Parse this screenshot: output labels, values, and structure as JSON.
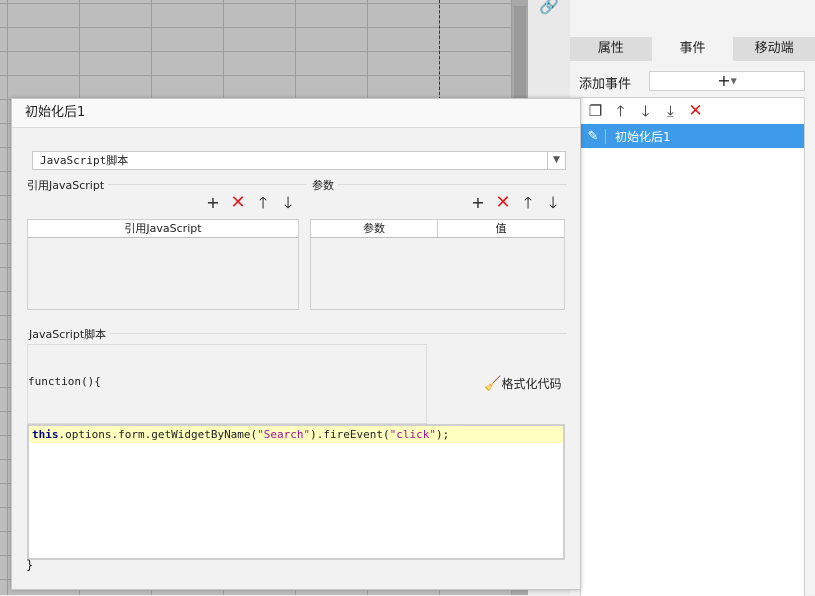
{
  "right_panel": {
    "tabs": [
      {
        "label": "属性",
        "active": false
      },
      {
        "label": "事件",
        "active": true
      },
      {
        "label": "移动端",
        "active": false
      }
    ],
    "add_event_label": "添加事件",
    "add_event_button": "+",
    "toolbar_icons": [
      "copy-icon",
      "arrow-up-icon",
      "arrow-down-icon",
      "move-to-bottom-icon",
      "delete-icon"
    ],
    "events": [
      {
        "label": "初始化后1",
        "selected": true
      }
    ],
    "accent_color": "#3e9bea"
  },
  "dialog": {
    "title": "初始化后1",
    "script_type": "JavaScript脚本",
    "ref_js": {
      "section_label": "引用JavaScript",
      "column": "引用JavaScript"
    },
    "params": {
      "section_label": "参数",
      "columns": [
        "参数",
        "值"
      ]
    },
    "script": {
      "section_label": "JavaScript脚本",
      "function_head": "function(){",
      "format_button": "格式化代码",
      "code": {
        "keyword": "this",
        "part1": ".options.form.getWidgetByName(",
        "str1": "\"Search\"",
        "part2": ").fireEvent(",
        "str2": "\"click\"",
        "part3": ");"
      },
      "function_close": "}"
    }
  }
}
